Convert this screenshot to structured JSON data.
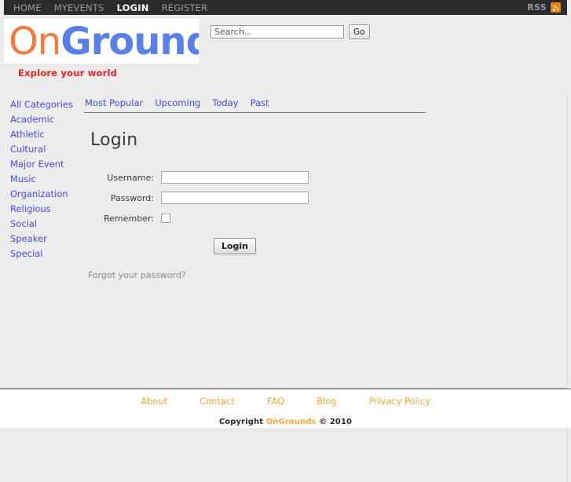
{
  "topnav": {
    "items": [
      {
        "label": "HOME",
        "active": false
      },
      {
        "label": "MYEVENTS",
        "active": false
      },
      {
        "label": "LOGIN",
        "active": true
      },
      {
        "label": "REGISTER",
        "active": false
      }
    ],
    "rss_label": "RSS",
    "rss_icon": "rss-feed-icon",
    "background": "#2b2b2b",
    "active_color": "#ffffff",
    "inactive_color": "#9a9a9a"
  },
  "header": {
    "logo_part1": "On",
    "logo_part2": "Grounds",
    "logo_color1": "#f4793b",
    "logo_color2": "#5b7fe8",
    "tagline": "Explore your world",
    "tagline_color": "#e8231f"
  },
  "search": {
    "value": "",
    "placeholder": "Search...",
    "button_label": "Go"
  },
  "sidebar": {
    "items": [
      {
        "label": "All Categories"
      },
      {
        "label": "Academic"
      },
      {
        "label": "Athletic"
      },
      {
        "label": "Cultural"
      },
      {
        "label": "Major Event"
      },
      {
        "label": "Music"
      },
      {
        "label": "Organization"
      },
      {
        "label": "Religious"
      },
      {
        "label": "Social"
      },
      {
        "label": "Speaker"
      },
      {
        "label": "Special"
      }
    ],
    "link_color": "#4b4bdd"
  },
  "main": {
    "tabs": [
      {
        "label": "Most Popular"
      },
      {
        "label": "Upcoming"
      },
      {
        "label": "Today"
      },
      {
        "label": "Past"
      }
    ],
    "title": "Login",
    "form": {
      "username_label": "Username:",
      "username_value": "",
      "password_label": "Password:",
      "password_value": "",
      "remember_label": "Remember:",
      "remember_checked": false,
      "submit_label": "Login"
    },
    "forgot_link": "Forgot your password?"
  },
  "footer": {
    "links": [
      {
        "label": "About"
      },
      {
        "label": "Contact"
      },
      {
        "label": "FAQ"
      },
      {
        "label": "Blog"
      },
      {
        "label": "Privacy Policy"
      }
    ],
    "link_color": "#f5a83c",
    "copyright_prefix": "Copyright",
    "copyright_brand": "OnGrounds",
    "copyright_suffix": "© 2010"
  }
}
